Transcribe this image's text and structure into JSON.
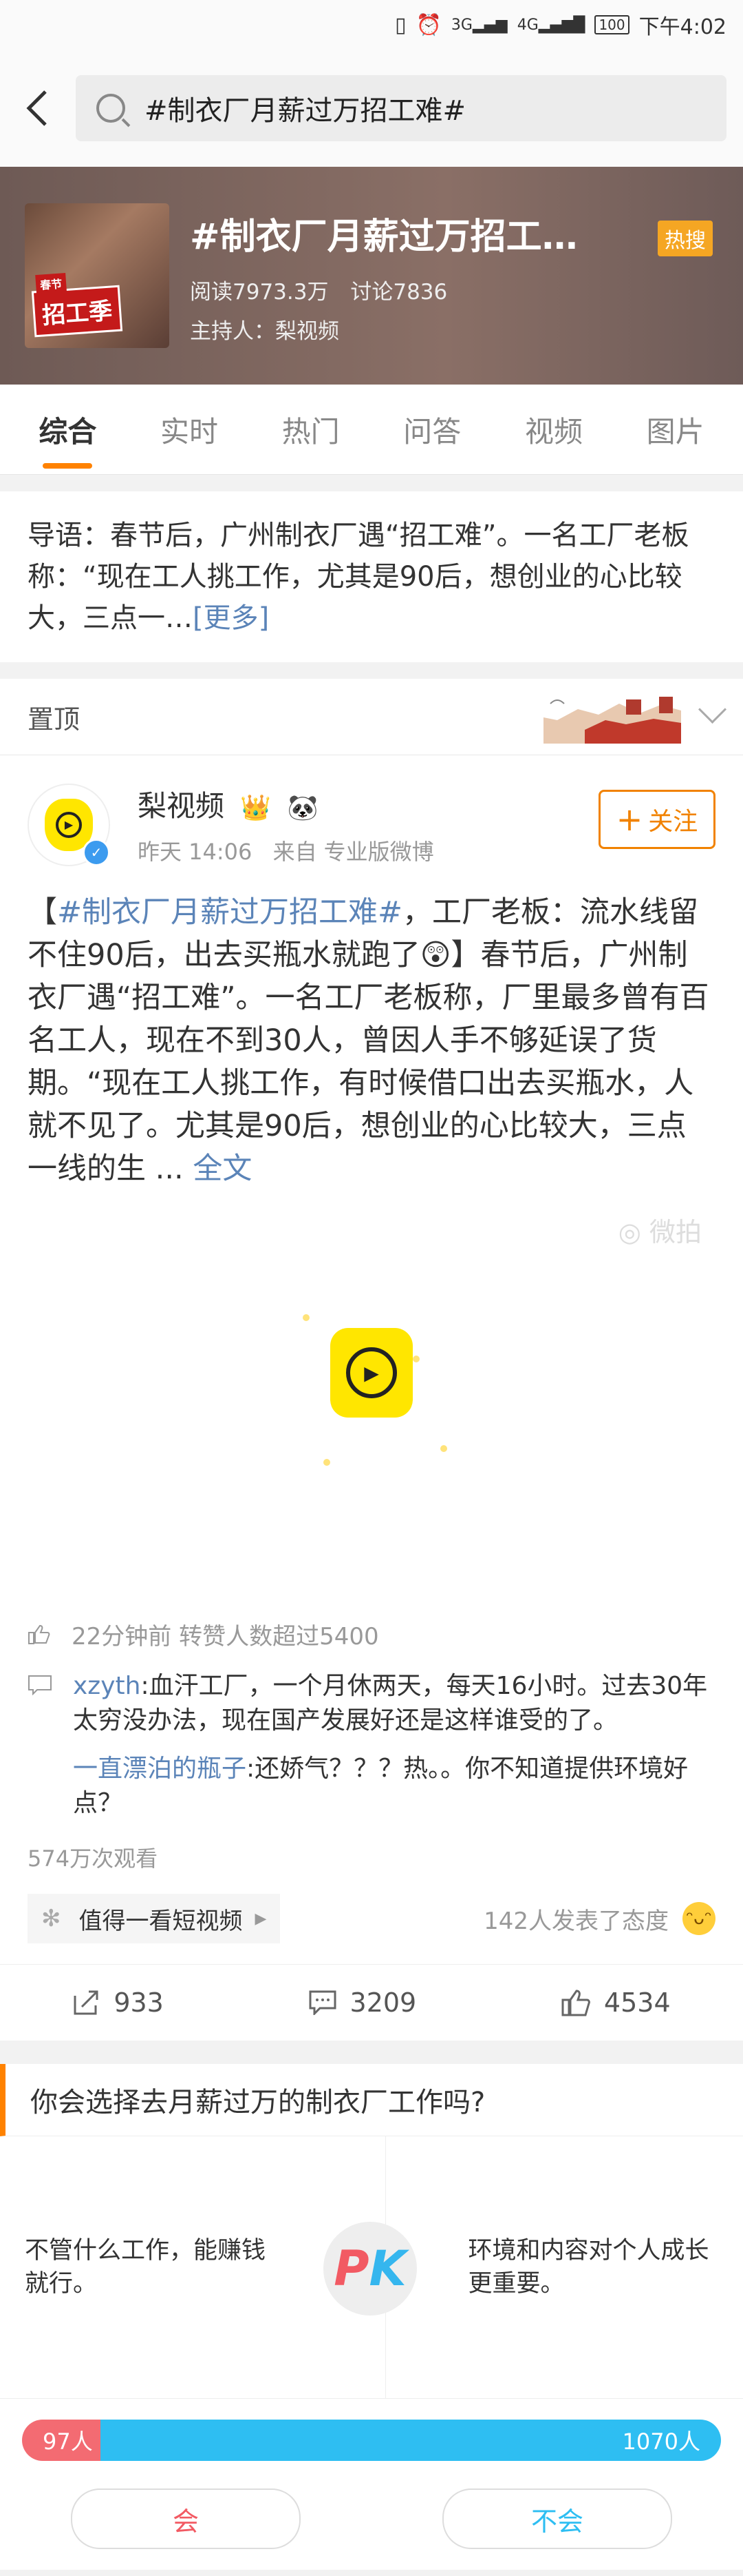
{
  "status_bar": {
    "time": "下午4:02",
    "battery": "100",
    "net1": "3G",
    "net2": "4G"
  },
  "search": {
    "query": "#制衣厂月薪过万招工难#"
  },
  "topic": {
    "title": "#制衣厂月薪过万招工…",
    "reads": "阅读7973.3万",
    "discussions": "讨论7836",
    "host": "主持人：梨视频",
    "hot_badge": "热搜",
    "thumb_tag": "招工季"
  },
  "tabs": [
    "综合",
    "实时",
    "热门",
    "问答",
    "视频",
    "图片"
  ],
  "intro": {
    "text": "导语：春节后，广州制衣厂遇“招工难”。一名工厂老板称：“现在工人挑工作，尤其是90后，想创业的心比较大，三点一…",
    "more": "[更多]"
  },
  "pinned": {
    "label": "置顶"
  },
  "post": {
    "author": "梨视频",
    "time": "昨天 14:06",
    "source_prefix": "来自",
    "source": "专业版微博",
    "follow": "关注",
    "text_open": "【",
    "hashtag": "#制衣厂月薪过万招工难#",
    "text_body": "，工厂老板：流水线留不住90后，出去买瓶水就跑了😲】春节后，广州制衣厂遇“招工难”。一名工厂老板称，厂里最多曾有百名工人，现在不到30人，曾因人手不够延误了货期。“现在工人挑工作，有时候借口出去买瓶水，人就不见了。尤其是90后，想创业的心比较大，三点一线的生 ...",
    "full_link": "全文",
    "watermark": "微拍",
    "activity": "22分钟前 转赞人数超过5400",
    "comments": [
      {
        "user": "xzyth",
        "text": ":血汗工厂，一个月休两天，每天16小时。过去30年太穷没办法，现在国产发展好还是这样谁受的了。"
      },
      {
        "user": "一直漂泊的瓶子",
        "text": ":还娇气？？？热。。你不知道提供环境好点？"
      }
    ],
    "views": "574万次观看",
    "short_video_btn": "值得一看短视频",
    "attitude": "142人发表了态度",
    "shares": "933",
    "comments_count": "3209",
    "likes": "4534"
  },
  "poll": {
    "question": "你会选择去月薪过万的制衣厂工作吗?",
    "option_left": "不管什么工作，能赚钱就行。",
    "option_right": "环境和内容对个人成长更重要。",
    "pk": "PK",
    "left_votes": "97人",
    "right_votes": "1070人",
    "left_fraction": 0.083,
    "yes_label": "会",
    "no_label": "不会"
  },
  "colors": {
    "accent": "#ff8200",
    "link": "#5b84b8",
    "poll_red": "#f36b72",
    "poll_blue": "#2ebef2"
  }
}
